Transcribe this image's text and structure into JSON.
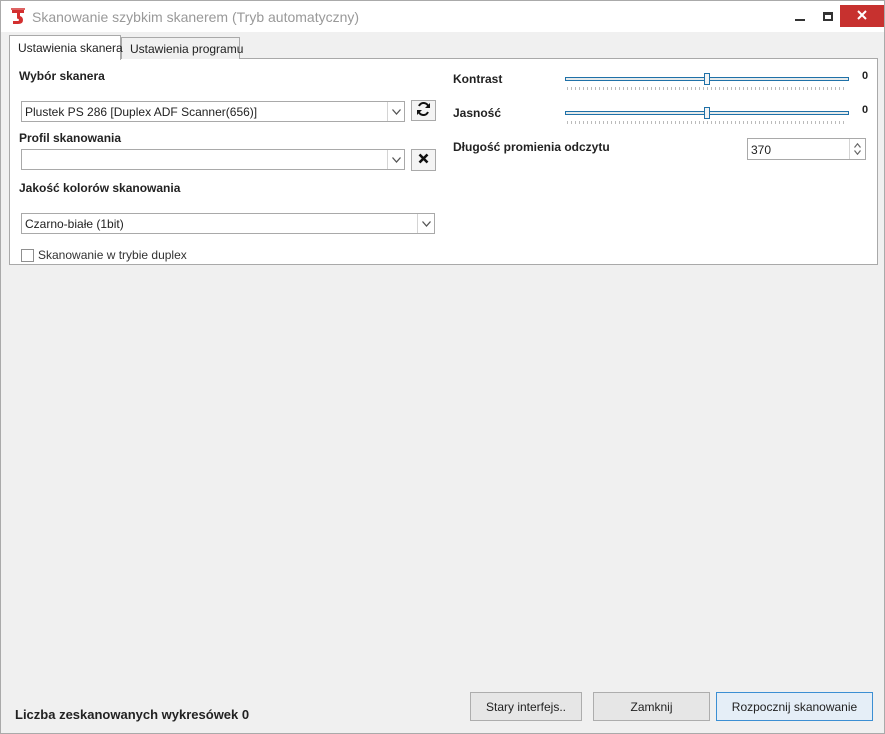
{
  "window": {
    "title": "Skanowanie szybkim skanerem (Tryb automatyczny)",
    "icon": "app-logo-icon",
    "accent_close": "#c7312f"
  },
  "tabs": [
    {
      "label": "Ustawienia skanera",
      "active": true
    },
    {
      "label": "Ustawienia programu",
      "active": false
    }
  ],
  "scanner_settings": {
    "scanner_select_label": "Wybór skanera",
    "scanner_value": "Plustek PS 286 [Duplex ADF Scanner(656)]",
    "profile_label": "Profil skanowania",
    "profile_value": "",
    "color_quality_label": "Jakość kolorów skanowania",
    "color_quality_value": "Czarno-białe (1bit)",
    "duplex_label": "Skanowanie w trybie duplex",
    "duplex_checked": false
  },
  "adjustments": {
    "contrast_label": "Kontrast",
    "contrast_value": "0",
    "contrast_level": 0.5,
    "brightness_label": "Jasność",
    "brightness_value": "0",
    "brightness_level": 0.5,
    "beam_length_label": "Długość promienia odczytu",
    "beam_length_value": "370"
  },
  "footer": {
    "status": "Liczba zeskanowanych wykresówek 0",
    "old_interface_label": "Stary interfejs..",
    "close_label": "Zamknij",
    "start_label": "Rozpocznij skanowanie"
  }
}
